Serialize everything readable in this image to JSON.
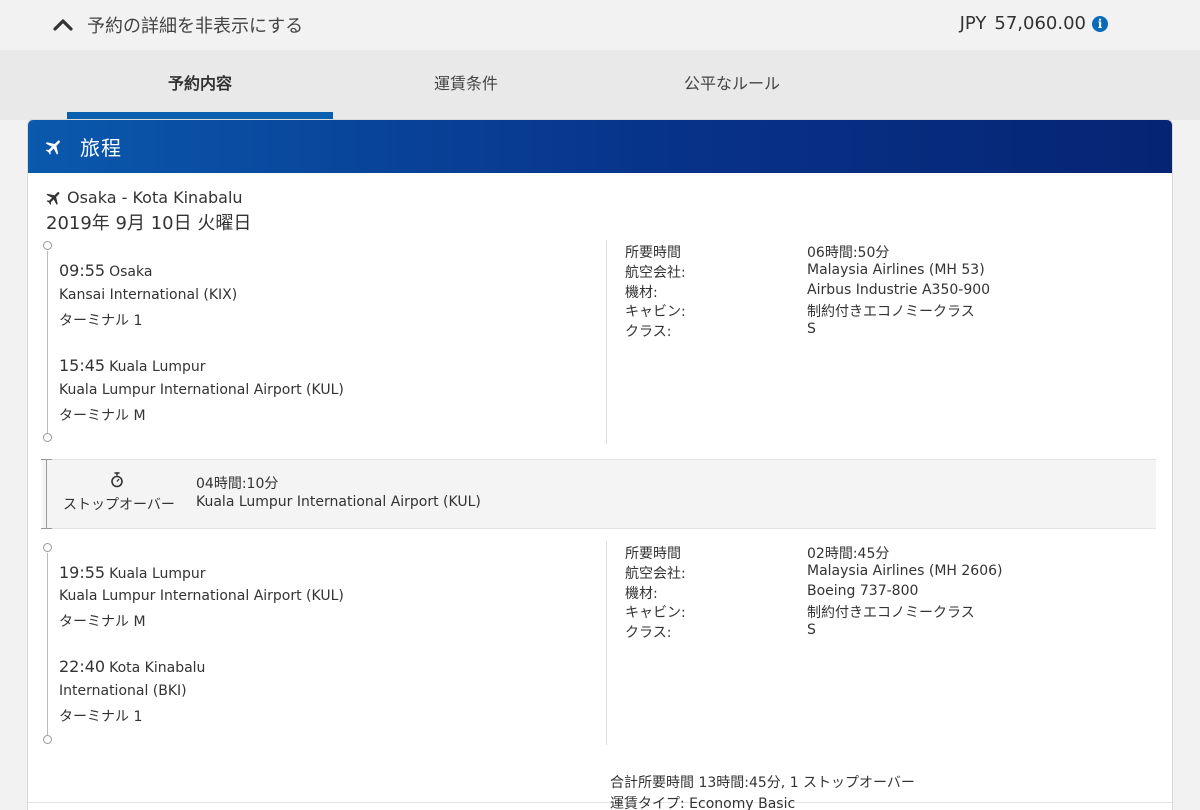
{
  "summary_bar": {
    "toggle_label": "予約の詳細を非表示にする",
    "price_currency": "JPY",
    "price_amount": "57,060.00"
  },
  "tabs": [
    {
      "label": "予約内容",
      "active": true
    },
    {
      "label": "運賃条件",
      "active": false
    },
    {
      "label": "公平なルール",
      "active": false
    }
  ],
  "itinerary": {
    "title": "旅程",
    "route": "Osaka - Kota Kinabalu",
    "date": "2019年 9月 10日 火曜日",
    "segments": [
      {
        "departure": {
          "time": "09:55",
          "city": "Osaka",
          "airport": "Kansai International (KIX)",
          "terminal": "ターミナル 1"
        },
        "arrival": {
          "time": "15:45",
          "city": "Kuala Lumpur",
          "airport": "Kuala Lumpur International Airport (KUL)",
          "terminal": "ターミナル M"
        },
        "details": [
          {
            "label": "所要時間",
            "value": "06時間:50分"
          },
          {
            "label": "航空会社:",
            "value": "Malaysia Airlines (MH 53)"
          },
          {
            "label": "機材:",
            "value": "Airbus Industrie A350-900"
          },
          {
            "label": "キャビン:",
            "value": "制約付きエコノミークラス"
          },
          {
            "label": "クラス:",
            "value": "S"
          }
        ]
      },
      {
        "departure": {
          "time": "19:55",
          "city": "Kuala Lumpur",
          "airport": "Kuala Lumpur International Airport (KUL)",
          "terminal": "ターミナル M"
        },
        "arrival": {
          "time": "22:40",
          "city": "Kota Kinabalu",
          "airport": "International (BKI)",
          "terminal": "ターミナル 1"
        },
        "details": [
          {
            "label": "所要時間",
            "value": "02時間:45分"
          },
          {
            "label": "航空会社:",
            "value": "Malaysia Airlines (MH 2606)"
          },
          {
            "label": "機材:",
            "value": "Boeing 737-800"
          },
          {
            "label": "キャビン:",
            "value": "制約付きエコノミークラス"
          },
          {
            "label": "クラス:",
            "value": "S"
          }
        ]
      }
    ],
    "stopover": {
      "label": "ストップオーバー",
      "duration": "04時間:10分",
      "airport": "Kuala Lumpur International Airport (KUL)"
    },
    "total": "合計所要時間 13時間:45分, 1 ストップオーバー",
    "fare_type": "運賃タイプ: Economy Basic"
  },
  "colors": {
    "header_gradient_start": "#0a59ad",
    "header_gradient_end": "#062473",
    "active_tab_underline": "#0a5fae",
    "info_icon": "#0a6ab8"
  },
  "icons": {
    "toggle": "chevron-up-icon",
    "price_info": "info-icon",
    "itinerary_header": "airplane-icon",
    "route": "airplane-icon",
    "stopover": "stopwatch-icon"
  }
}
